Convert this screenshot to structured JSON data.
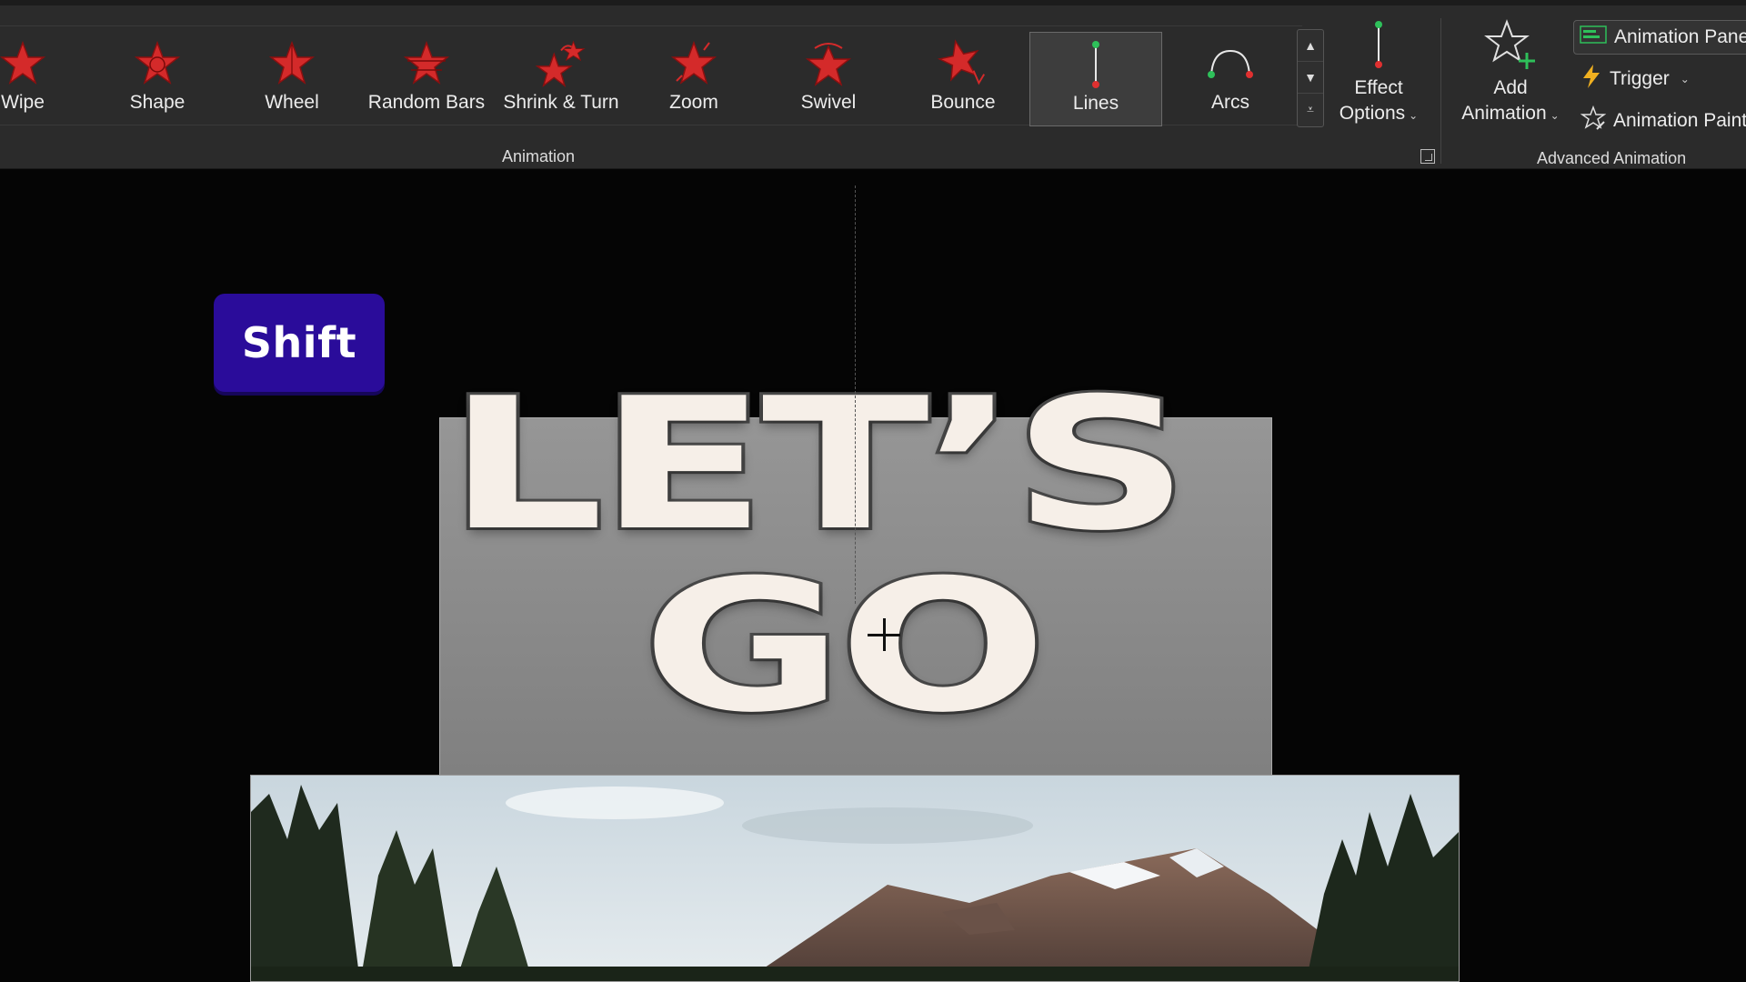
{
  "ribbon": {
    "animation_gallery": [
      {
        "label": "Wipe",
        "icon": "wipe-star-icon"
      },
      {
        "label": "Shape",
        "icon": "shape-star-icon"
      },
      {
        "label": "Wheel",
        "icon": "wheel-star-icon"
      },
      {
        "label": "Random Bars",
        "icon": "random-bars-star-icon"
      },
      {
        "label": "Shrink & Turn",
        "icon": "shrink-turn-star-icon"
      },
      {
        "label": "Zoom",
        "icon": "zoom-star-icon"
      },
      {
        "label": "Swivel",
        "icon": "swivel-star-icon"
      },
      {
        "label": "Bounce",
        "icon": "bounce-star-icon"
      },
      {
        "label": "Lines",
        "icon": "lines-path-icon",
        "selected": true
      },
      {
        "label": "Arcs",
        "icon": "arcs-path-icon"
      }
    ],
    "animation_group_label": "Animation",
    "effect_options": {
      "line1": "Effect",
      "line2": "Options"
    },
    "add_animation": {
      "line1": "Add",
      "line2": "Animation"
    },
    "animation_pane": "Animation Pane",
    "trigger": "Trigger",
    "animation_painter": "Animation Painter",
    "advanced_group_label": "Advanced Animation"
  },
  "slide": {
    "shift_key_label": "Shift",
    "title_line1": "LET’S",
    "title_line2": "GO"
  },
  "colors": {
    "ribbon_bg": "#2b2b2b",
    "star_red": "#d42a2a",
    "shift_key": "#2a0c9a",
    "title_fill": "#f6efe8"
  }
}
